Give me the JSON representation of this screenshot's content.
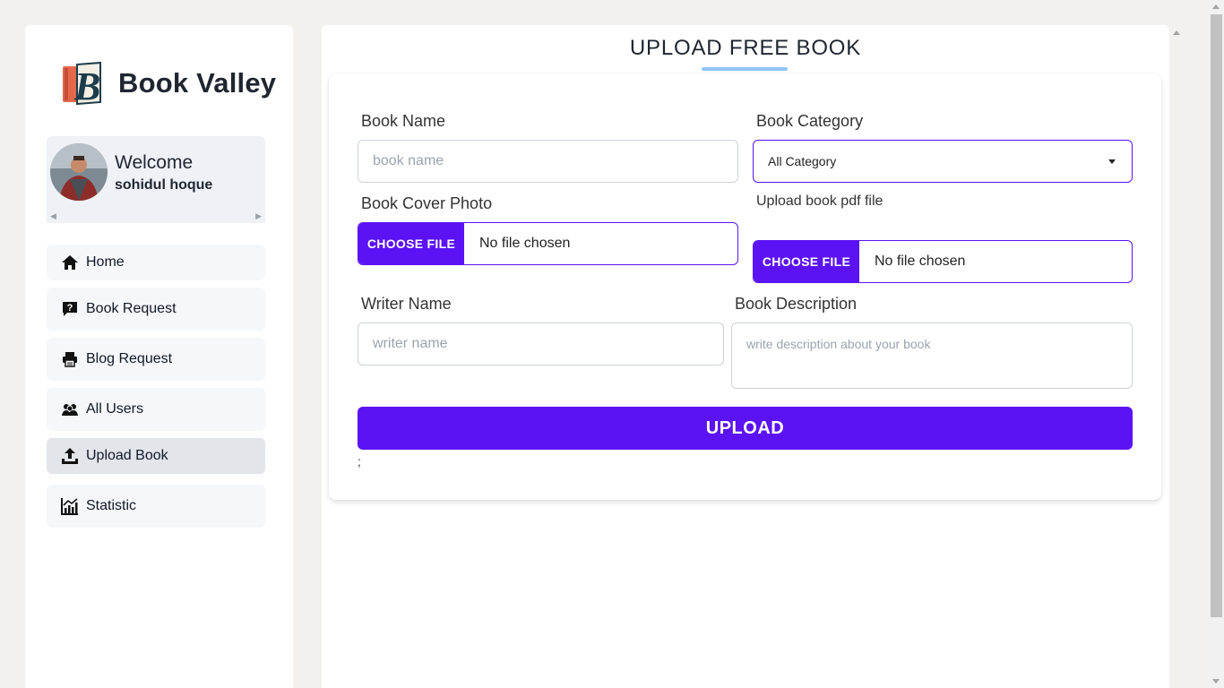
{
  "brand": {
    "name": "Book Valley",
    "logo_letter": "B",
    "colors": {
      "book_red": "#e4684c",
      "book_dark": "#1d3c4a"
    }
  },
  "welcome": {
    "title": "Welcome",
    "user_name": "sohidul hoque"
  },
  "nav": {
    "items": [
      {
        "label": "Home",
        "icon": "home-icon",
        "active": false
      },
      {
        "label": "Book Request",
        "icon": "question-bubble-icon",
        "active": false
      },
      {
        "label": "Blog Request",
        "icon": "printer-icon",
        "active": false
      },
      {
        "label": "All Users",
        "icon": "users-icon",
        "active": false
      },
      {
        "label": "Upload Book",
        "icon": "upload-icon",
        "active": true
      },
      {
        "label": "Statistic",
        "icon": "chart-icon",
        "active": false
      }
    ]
  },
  "page": {
    "title": "UPLOAD FREE BOOK"
  },
  "form": {
    "book_name": {
      "label": "Book Name",
      "placeholder": "book name",
      "value": ""
    },
    "book_category": {
      "label": "Book Category",
      "selected": "All Category"
    },
    "cover_photo": {
      "label": "Book Cover Photo",
      "button": "CHOOSE FILE",
      "status": "No file chosen"
    },
    "pdf_file": {
      "label": "Upload book pdf file",
      "button": "CHOOSE FILE",
      "status": "No file chosen"
    },
    "writer_name": {
      "label": "Writer Name",
      "placeholder": "writer name",
      "value": ""
    },
    "description": {
      "label": "Book Description",
      "placeholder": "write description about your book",
      "value": ""
    },
    "submit_label": "UPLOAD",
    "trailing_text": ";"
  },
  "colors": {
    "accent": "#5b13f5",
    "underline": "#93c5fd",
    "page_bg": "#f2f1ed",
    "welcome_bg": "#eef1f5"
  }
}
